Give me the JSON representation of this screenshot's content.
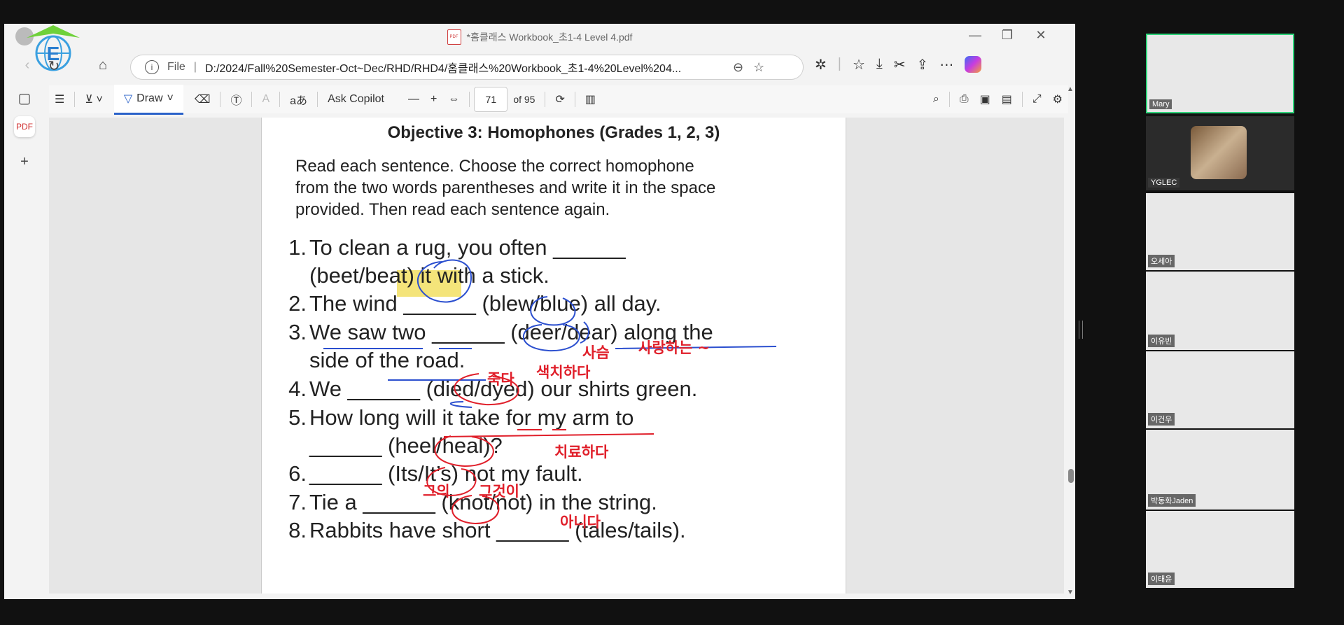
{
  "window": {
    "title": "*홈클래스 Workbook_초1-4 Level 4.pdf",
    "minimize": "—",
    "restore": "❐",
    "close": "✕"
  },
  "address": {
    "scheme_label": "File",
    "url": "D:/2024/Fall%20Semester-Oct~Dec/RHD/RHD4/홈클래스%20Workbook_초1-4%20Level%204..."
  },
  "toolbar": {
    "draw_label": "Draw",
    "copilot_label": "Ask Copilot",
    "page_current": "71",
    "page_total": "of 95",
    "text_icon_label": "aあ",
    "minus": "—",
    "plus": "+"
  },
  "pdf": {
    "heading": "Objective 3: Homophones (Grades 1, 2, 3)",
    "instructions": [
      "Read each sentence. Choose the correct homophone",
      "from the two words parentheses and write it in the space",
      "provided. Then read each sentence again."
    ],
    "questions": [
      {
        "num": "1.",
        "text": "To clean a rug, you often ______"
      },
      {
        "num": "",
        "text": "(beet/beat) it with a stick."
      },
      {
        "num": "2.",
        "text": "The wind ______ (blew/blue) all day."
      },
      {
        "num": "3.",
        "text": "We saw two ______ (deer/dear) along the"
      },
      {
        "num": "",
        "text": "side of the road."
      },
      {
        "num": "4.",
        "text": "We ______ (died/dyed) our shirts green."
      },
      {
        "num": "5.",
        "text": "How long will it take for my arm to"
      },
      {
        "num": "",
        "text": "______ (heel/heal)?"
      },
      {
        "num": "6.",
        "text": "______ (Its/It’s) not my fault."
      },
      {
        "num": "7.",
        "text": "Tie a ______ (knot/not) in the string."
      },
      {
        "num": "8.",
        "text": "Rabbits have short ______ (tales/tails)."
      }
    ],
    "annotations": [
      {
        "text": "사슴"
      },
      {
        "text": "사랑하는 ~"
      },
      {
        "text": "색치하다"
      },
      {
        "text": "죽다"
      },
      {
        "text": "치료하다"
      },
      {
        "text": "그의"
      },
      {
        "text": "그것이"
      },
      {
        "text": "아니다"
      }
    ]
  },
  "participants": [
    {
      "name": "Mary"
    },
    {
      "name": "YGLEC"
    },
    {
      "name": "오세아"
    },
    {
      "name": "이유빈"
    },
    {
      "name": "이건우"
    },
    {
      "name": "박동화Jaden"
    },
    {
      "name": "이태윤"
    }
  ],
  "colors": {
    "annotation_red": "#e01f2a",
    "annotation_blue": "#2b4fcf",
    "highlight_yellow": "#f4e47a",
    "active_tile_border": "#2ed47a"
  }
}
